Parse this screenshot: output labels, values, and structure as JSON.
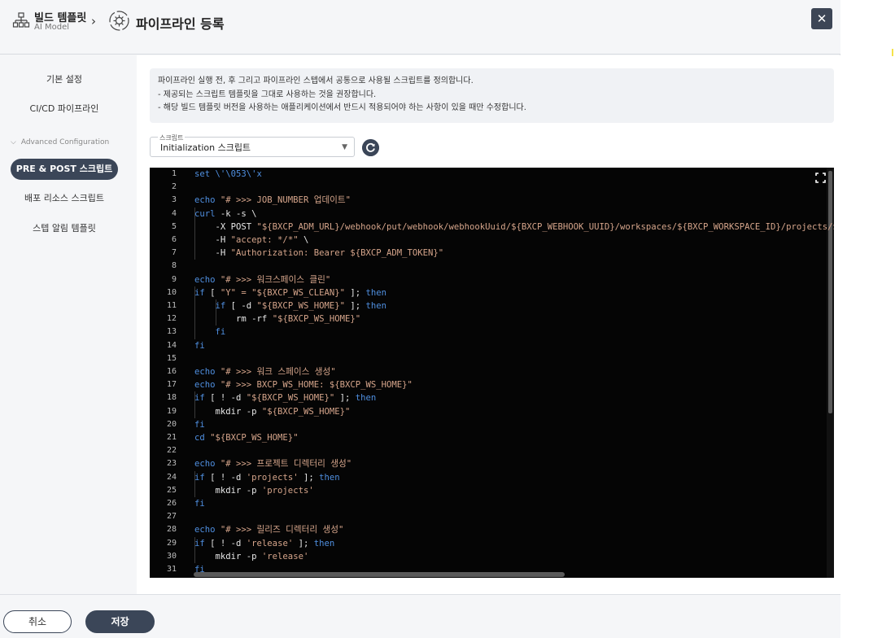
{
  "header": {
    "breadcrumb_title": "빌드 템플릿",
    "breadcrumb_sub": "AI Model",
    "chevron": "›",
    "page_title": "파이프라인 등록",
    "close_label": "✕",
    "icons": {
      "breadcrumb": "template-tree-icon",
      "page": "pipeline-cycle-icon"
    }
  },
  "sidebar": {
    "items": [
      {
        "label": "기본 설정"
      },
      {
        "label": "CI/CD 파이프라인"
      },
      {
        "label": "PRE & POST 스크립트",
        "active": true
      },
      {
        "label": "배포 리소스 스크립트"
      },
      {
        "label": "스텝 알림 템플릿"
      }
    ],
    "group_label": "Advanced Configuration"
  },
  "main": {
    "info_lines": [
      "파이프라인 실행 전, 후 그리고 파이프라인 스텝에서 공통으로 사용될 스크립트를 정의합니다.",
      "- 제공되는 스크립트 템플릿을 그대로 사용하는 것을 권장합니다.",
      "- 해당 빌드 템플릿 버전을 사용하는 애플리케이션에서 반드시 적용되어야 하는 사항이 있을 때만 수정합니다."
    ],
    "select": {
      "label": "스크립트",
      "value": "Initialization 스크립트"
    }
  },
  "editor": {
    "line_numbers": [
      "1",
      "2",
      "3",
      "4",
      "5",
      "6",
      "7",
      "8",
      "9",
      "10",
      "11",
      "12",
      "13",
      "14",
      "15",
      "16",
      "17",
      "18",
      "19",
      "20",
      "21",
      "22",
      "23",
      "24",
      "25",
      "26",
      "27",
      "28",
      "29",
      "30",
      "31"
    ],
    "lines": [
      [
        [
          "set \\'\\053\\'x",
          "k"
        ]
      ],
      [],
      [
        [
          "echo ",
          "k"
        ],
        [
          "\"# >>> JOB_NUMBER 업데이트\"",
          "s"
        ]
      ],
      [
        [
          "curl ",
          "k"
        ],
        [
          "-k -s \\",
          "f"
        ]
      ],
      [
        [
          "    -X POST ",
          "f"
        ],
        [
          "\"${BXCP_ADM_URL}/webhook/put/webhook/webhookUuid/${BXCP_WEBHOOK_UUID}/workspaces/${BXCP_WORKSPACE_ID}/projects/${BXCP_PROJECT_ID}\"",
          "s"
        ],
        [
          "\\",
          "f"
        ]
      ],
      [
        [
          "    -H ",
          "f"
        ],
        [
          "\"accept: */*\" ",
          "s"
        ],
        [
          "\\",
          "f"
        ]
      ],
      [
        [
          "    -H ",
          "f"
        ],
        [
          "\"Authorization: Bearer ${BXCP_ADM_TOKEN}\"",
          "s"
        ]
      ],
      [],
      [
        [
          "echo ",
          "k"
        ],
        [
          "\"# >>> 워크스페이스 클린\"",
          "s"
        ]
      ],
      [
        [
          "if ",
          "k"
        ],
        [
          "[ ",
          "f"
        ],
        [
          "\"Y\" = \"${BXCP_WS_CLEAN}\" ",
          "s"
        ],
        [
          "]; ",
          "f"
        ],
        [
          "then",
          "k"
        ]
      ],
      [
        [
          "    if ",
          "k"
        ],
        [
          "[ -d ",
          "f"
        ],
        [
          "\"${BXCP_WS_HOME}\" ",
          "s"
        ],
        [
          "]; ",
          "f"
        ],
        [
          "then",
          "k"
        ]
      ],
      [
        [
          "        rm ",
          "f"
        ],
        [
          "-rf ",
          "f"
        ],
        [
          "\"${BXCP_WS_HOME}\"",
          "s"
        ]
      ],
      [
        [
          "    fi",
          "k"
        ]
      ],
      [
        [
          "fi",
          "k"
        ]
      ],
      [],
      [
        [
          "echo ",
          "k"
        ],
        [
          "\"# >>> 워크 스페이스 생성\"",
          "s"
        ]
      ],
      [
        [
          "echo ",
          "k"
        ],
        [
          "\"# >>> BXCP_WS_HOME: ${BXCP_WS_HOME}\"",
          "s"
        ]
      ],
      [
        [
          "if ",
          "k"
        ],
        [
          "[ ! -d ",
          "f"
        ],
        [
          "\"${BXCP_WS_HOME}\" ",
          "s"
        ],
        [
          "]; ",
          "f"
        ],
        [
          "then",
          "k"
        ]
      ],
      [
        [
          "    mkdir ",
          "f"
        ],
        [
          "-p ",
          "f"
        ],
        [
          "\"${BXCP_WS_HOME}\"",
          "s"
        ]
      ],
      [
        [
          "fi",
          "k"
        ]
      ],
      [
        [
          "cd ",
          "k"
        ],
        [
          "\"${BXCP_WS_HOME}\"",
          "s"
        ]
      ],
      [],
      [
        [
          "echo ",
          "k"
        ],
        [
          "\"# >>> 프로젝트 디렉터리 생성\"",
          "s"
        ]
      ],
      [
        [
          "if ",
          "k"
        ],
        [
          "[ ! -d ",
          "f"
        ],
        [
          "'projects' ",
          "s"
        ],
        [
          "]; ",
          "f"
        ],
        [
          "then",
          "k"
        ]
      ],
      [
        [
          "    mkdir ",
          "f"
        ],
        [
          "-p ",
          "f"
        ],
        [
          "'projects'",
          "s"
        ]
      ],
      [
        [
          "fi",
          "k"
        ]
      ],
      [],
      [
        [
          "echo ",
          "k"
        ],
        [
          "\"# >>> 릴리즈 디렉터리 생성\"",
          "s"
        ]
      ],
      [
        [
          "if ",
          "k"
        ],
        [
          "[ ! -d ",
          "f"
        ],
        [
          "'release' ",
          "s"
        ],
        [
          "]; ",
          "f"
        ],
        [
          "then",
          "k"
        ]
      ],
      [
        [
          "    mkdir ",
          "f"
        ],
        [
          "-p ",
          "f"
        ],
        [
          "'release'",
          "s"
        ]
      ],
      [
        [
          "fi",
          "k"
        ]
      ]
    ],
    "expand_icon": "expand-icon"
  },
  "footer": {
    "cancel_label": "취소",
    "save_label": "저장"
  }
}
